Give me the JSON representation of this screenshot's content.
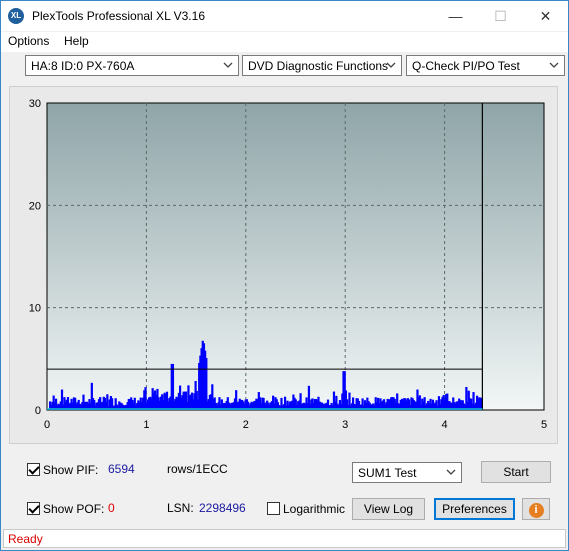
{
  "window": {
    "title": "PlexTools Professional XL V3.16",
    "icon_text": "XL",
    "minimize": "—",
    "maximize": "☐",
    "close": "✕"
  },
  "menu": {
    "options": "Options",
    "help": "Help"
  },
  "toolbar": {
    "drive": "HA:8 ID:0  PX-760A",
    "function": "DVD Diagnostic Functions",
    "test": "Q-Check PI/PO Test"
  },
  "chart_data": {
    "type": "bar",
    "xlim": [
      0,
      5
    ],
    "ylim": [
      0,
      30
    ],
    "xticks": [
      "0",
      "1",
      "2",
      "3",
      "4",
      "5"
    ],
    "yticks": [
      "0",
      "10",
      "20",
      "30"
    ],
    "threshold": 4,
    "end_marker": 4.38,
    "grid": true,
    "background_gradient": [
      "#8fa5a8",
      "#f2f6f6"
    ],
    "bar_color": "#0000ff",
    "peak": {
      "x": 1.56,
      "y": 7
    }
  },
  "controls": {
    "show_pif_label": "Show PIF:",
    "pif_value": "6594",
    "pif_unit": "rows/1ECC",
    "show_pof_label": "Show POF:",
    "pof_value": "0",
    "lsn_label": "LSN:",
    "lsn_value": "2298496",
    "logarithmic_label": "Logarithmic",
    "sum_test": "SUM1 Test",
    "start": "Start",
    "view_log": "View Log",
    "preferences": "Preferences",
    "info_icon": "i"
  },
  "status": {
    "text": "Ready",
    "color": "#dd0000"
  }
}
